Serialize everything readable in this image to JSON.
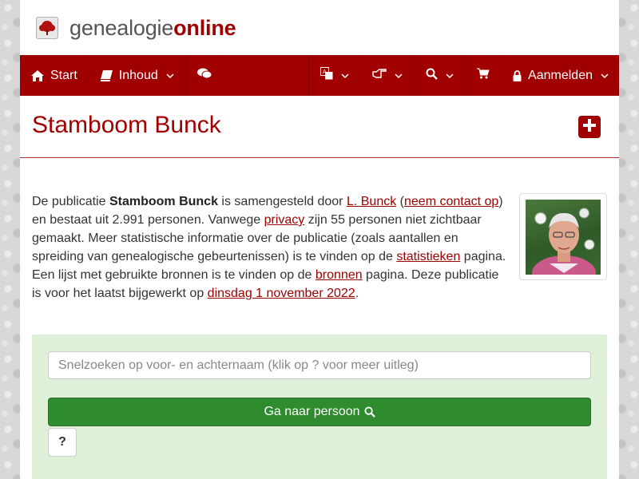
{
  "brand": {
    "name_part1": "genealogie",
    "name_part2": "online",
    "logo_icon": "tree-icon"
  },
  "nav": {
    "start": "Start",
    "inhoud": "Inhoud",
    "chat_icon": "comments-icon",
    "language_icon": "translate-icon",
    "pointer_icon": "hand-point-right-icon",
    "search_icon": "search-icon",
    "cart_icon": "shopping-cart-icon",
    "login": "Aanmelden"
  },
  "title": "Stamboom Bunck",
  "intro": {
    "t1": "De publicatie ",
    "pub_name": "Stamboom Bunck",
    "t2": " is samengesteld door ",
    "author_link": "L. Bunck",
    "t3": " (",
    "contact_link": "neem contact op",
    "t4": ") en bestaat uit 2.991 personen. Vanwege ",
    "privacy_link": "privacy",
    "t5": " zijn 55 personen niet zichtbaar gemaakt. Meer statistische informatie over de publicatie (zoals aantallen en spreiding van genealogische gebeurtenissen) is te vinden op de ",
    "stats_link": "statistieken",
    "t6": " pagina. Een lijst met gebruikte bronnen is te vinden op de ",
    "sources_link": "bronnen",
    "t7": " pagina. Deze publicatie is voor het laatst bijgewerkt op ",
    "date_link": "dinsdag 1 november 2022",
    "t8": "."
  },
  "search": {
    "placeholder": "Snelzoeken op voor- en achternaam (klik op ? voor meer uitleg)",
    "button": "Ga naar persoon",
    "help": "?"
  },
  "colors": {
    "brand_red": "#a00000",
    "panel_green": "#dff0d8",
    "button_green": "#2e8b2e"
  }
}
